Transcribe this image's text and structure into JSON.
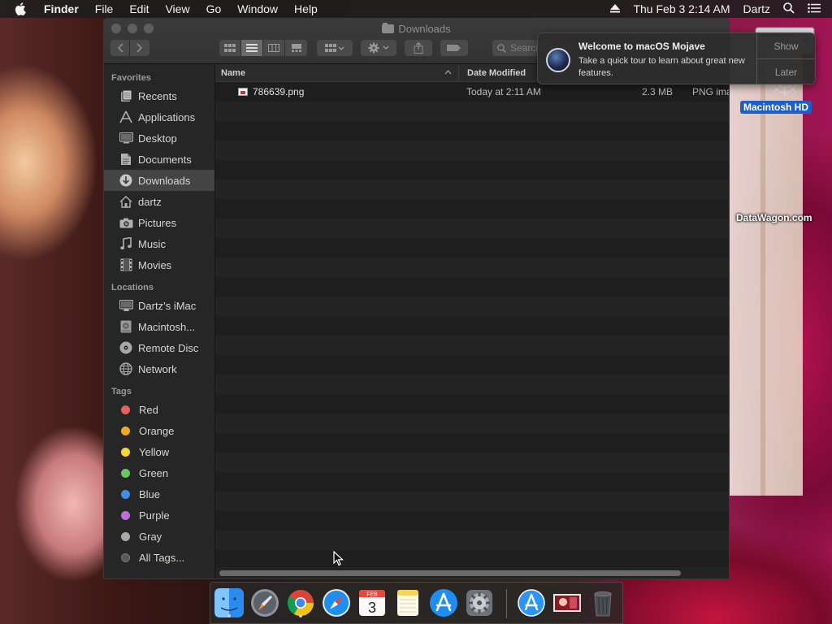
{
  "menubar": {
    "items": [
      "Finder",
      "File",
      "Edit",
      "View",
      "Go",
      "Window",
      "Help"
    ],
    "clock": "Thu Feb 3  2:14 AM",
    "user": "Dartz"
  },
  "window": {
    "title": "Downloads",
    "search_placeholder": "Search"
  },
  "sidebar": {
    "favorites_heading": "Favorites",
    "favorites": [
      {
        "label": "Recents",
        "icon": "recents-icon"
      },
      {
        "label": "Applications",
        "icon": "applications-icon"
      },
      {
        "label": "Desktop",
        "icon": "desktop-icon"
      },
      {
        "label": "Documents",
        "icon": "documents-icon"
      },
      {
        "label": "Downloads",
        "icon": "downloads-icon",
        "selected": true
      },
      {
        "label": "dartz",
        "icon": "home-icon"
      },
      {
        "label": "Pictures",
        "icon": "pictures-icon"
      },
      {
        "label": "Music",
        "icon": "music-icon"
      },
      {
        "label": "Movies",
        "icon": "movies-icon"
      }
    ],
    "locations_heading": "Locations",
    "locations": [
      {
        "label": "Dartz’s iMac",
        "icon": "imac-icon"
      },
      {
        "label": "Macintosh...",
        "icon": "hard-disk-icon"
      },
      {
        "label": "Remote Disc",
        "icon": "disc-icon"
      },
      {
        "label": "Network",
        "icon": "network-icon"
      }
    ],
    "tags_heading": "Tags",
    "tags": [
      {
        "label": "Red",
        "color": "#ec5f5a"
      },
      {
        "label": "Orange",
        "color": "#f5a623"
      },
      {
        "label": "Yellow",
        "color": "#f7d72f"
      },
      {
        "label": "Green",
        "color": "#5fce5b"
      },
      {
        "label": "Blue",
        "color": "#3e8ef0"
      },
      {
        "label": "Purple",
        "color": "#c46be0"
      },
      {
        "label": "Gray",
        "color": "#a8a8a8"
      },
      {
        "label": "All Tags...",
        "color": "#5a5a5a"
      }
    ]
  },
  "file_list": {
    "columns": {
      "name": "Name",
      "date": "Date Modified"
    },
    "files": [
      {
        "name": "786639.png",
        "date": "Today at 2:11 AM",
        "size": "2.3 MB",
        "kind": "PNG image"
      }
    ]
  },
  "notification": {
    "title": "Welcome to macOS Mojave",
    "body": "Take a quick tour to learn about great new features.",
    "show_label": "Show",
    "later_label": "Later"
  },
  "desktop": {
    "disk_label": "Macintosh HD",
    "watermark": "DataWagon.com"
  },
  "dock": {
    "items": [
      "finder-icon",
      "launchpad-icon",
      "chrome-icon",
      "safari-icon",
      "calendar-icon",
      "notes-icon",
      "app-store-icon",
      "system-preferences-icon",
      "app-store-downloads-icon",
      "photo-icon",
      "trash-icon"
    ],
    "calendar_month": "FEB",
    "calendar_day": "3"
  }
}
